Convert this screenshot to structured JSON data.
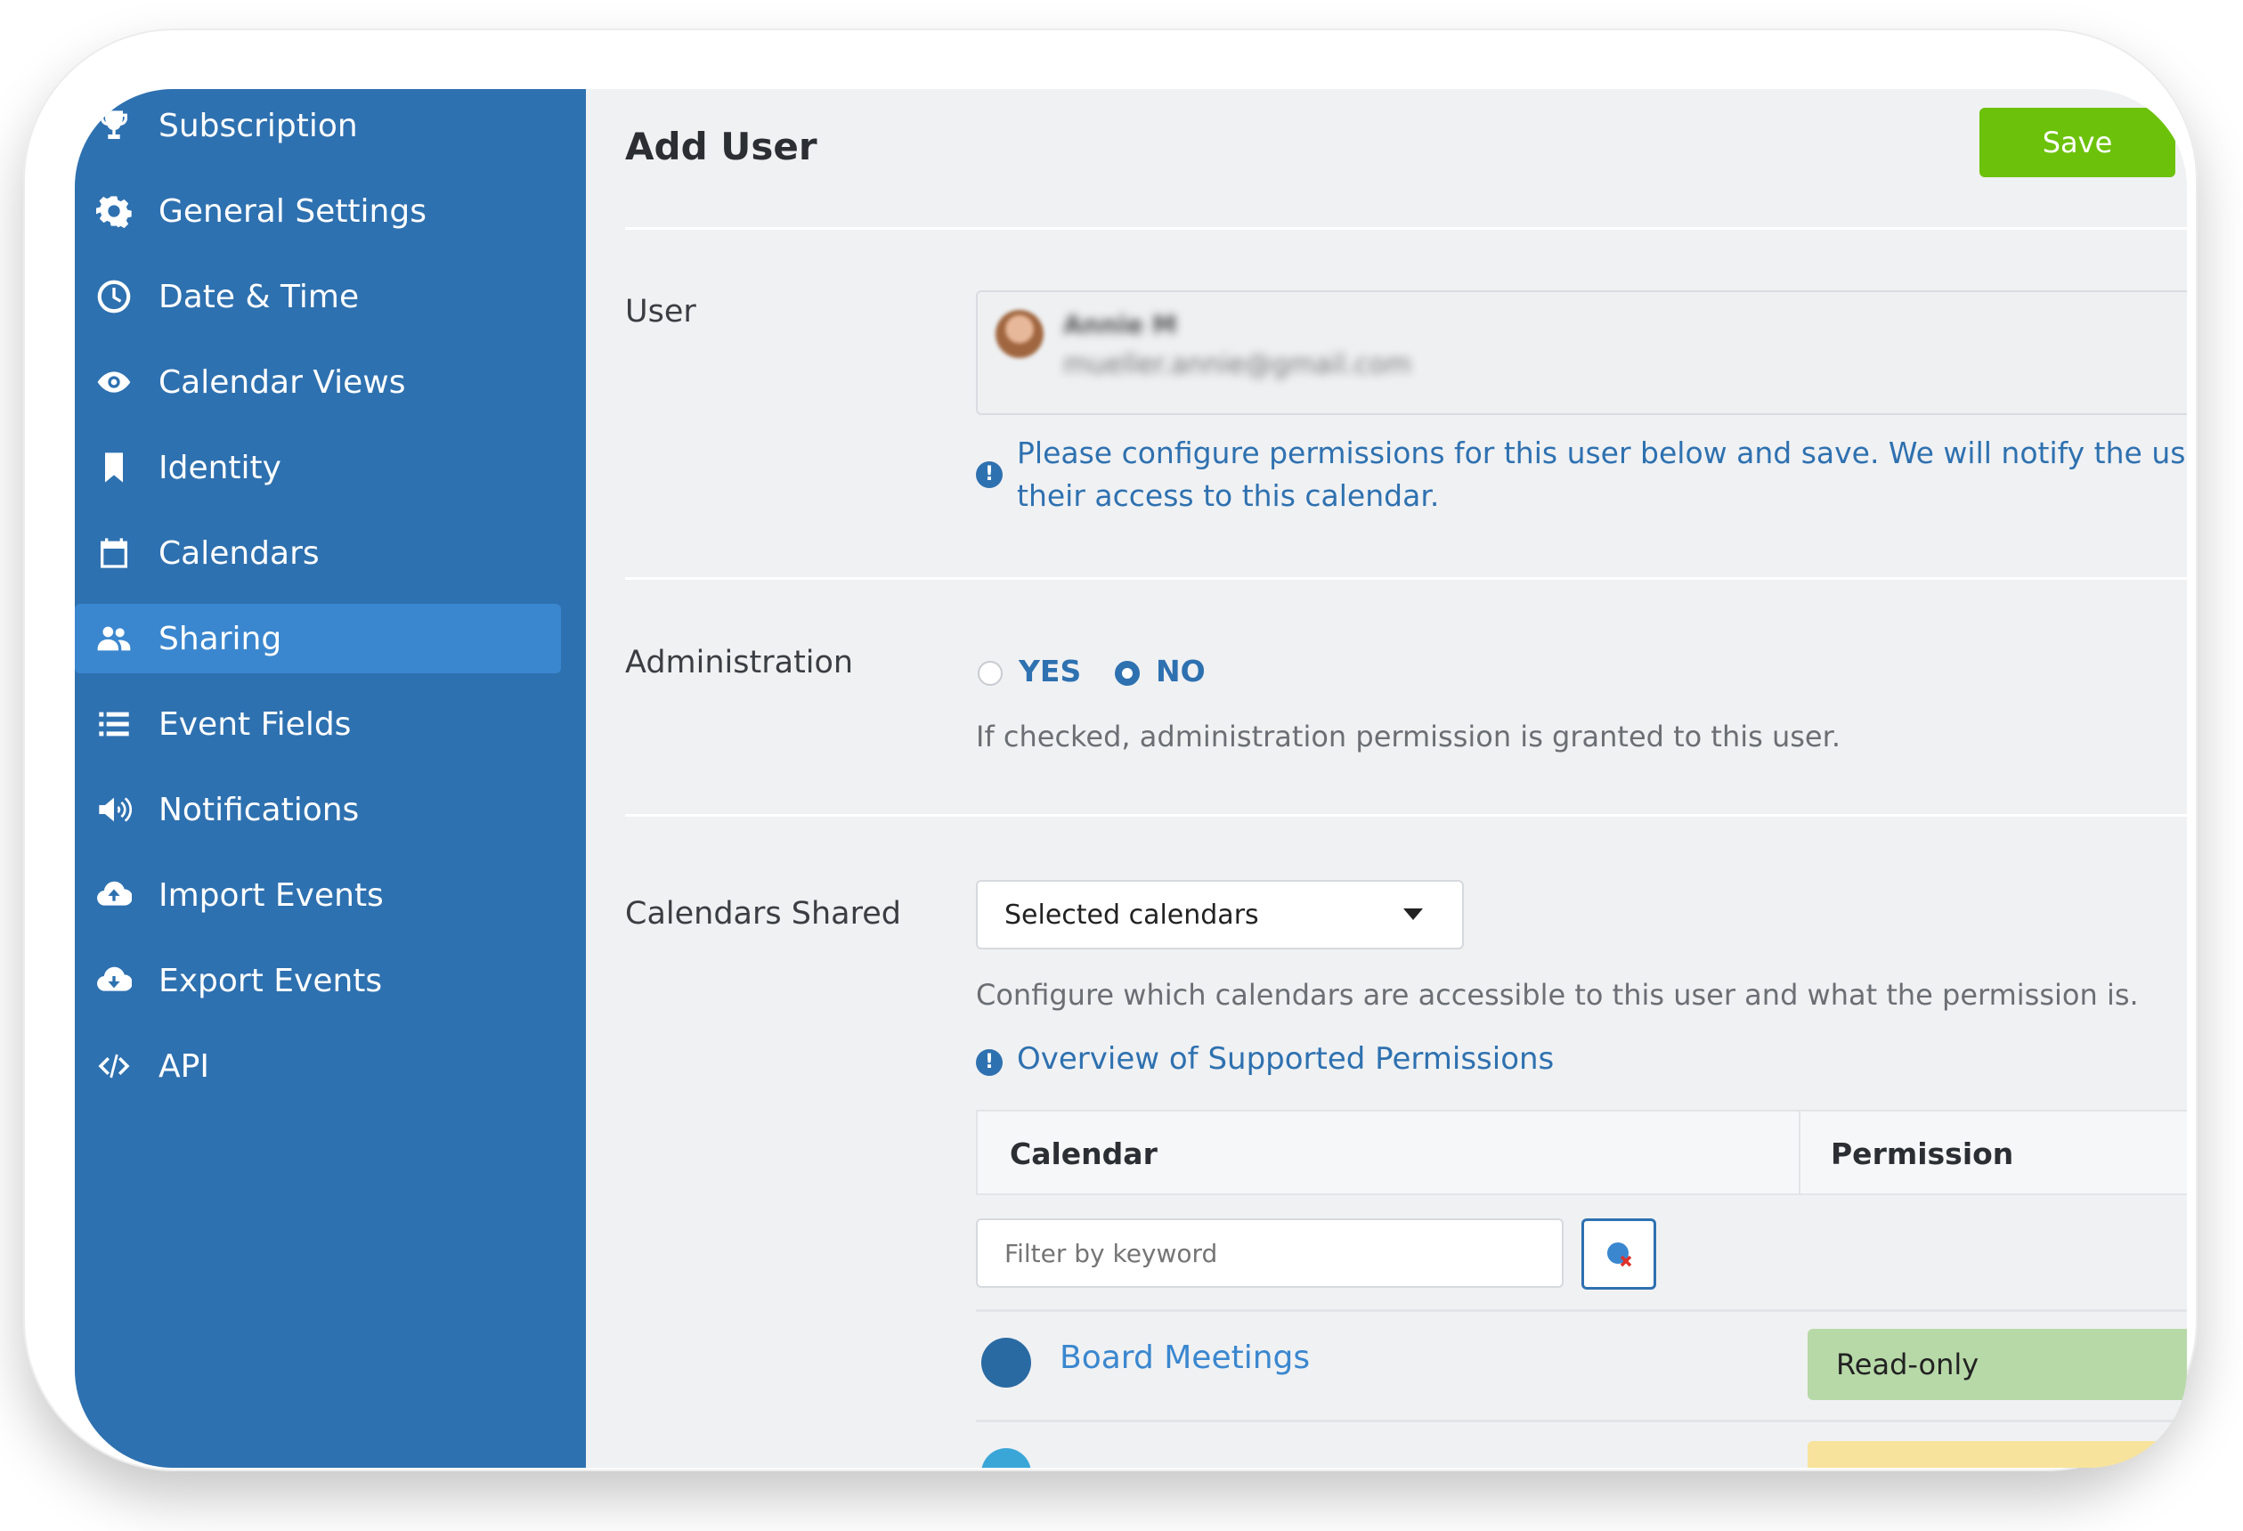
{
  "sidebar": {
    "items": [
      {
        "label": "Subscription",
        "icon": "trophy-icon"
      },
      {
        "label": "General Settings",
        "icon": "gear-icon"
      },
      {
        "label": "Date & Time",
        "icon": "clock-icon"
      },
      {
        "label": "Calendar Views",
        "icon": "eye-icon"
      },
      {
        "label": "Identity",
        "icon": "bookmark-icon"
      },
      {
        "label": "Calendars",
        "icon": "calendar-icon"
      },
      {
        "label": "Sharing",
        "icon": "users-icon",
        "active": true
      },
      {
        "label": "Event Fields",
        "icon": "list-icon"
      },
      {
        "label": "Notifications",
        "icon": "megaphone-icon"
      },
      {
        "label": "Import Events",
        "icon": "cloud-upload-icon"
      },
      {
        "label": "Export Events",
        "icon": "cloud-download-icon"
      },
      {
        "label": "API",
        "icon": "code-icon"
      }
    ]
  },
  "header": {
    "title": "Add User",
    "save_label": "Save"
  },
  "user_section": {
    "label": "User",
    "name": "Annie M",
    "email": "mueller.annie@gmail.com",
    "notice_line1": "Please configure permissions for this user below and save. We will notify the user by e",
    "notice_line2": "their access to this calendar."
  },
  "admin_section": {
    "label": "Administration",
    "yes_label": "YES",
    "no_label": "NO",
    "selected": "NO",
    "help": "If checked, administration permission is granted to this user."
  },
  "calendars_section": {
    "label": "Calendars Shared",
    "select_value": "Selected calendars",
    "help": "Configure which calendars are accessible to this user and what the permission is.",
    "overview_link": "Overview of Supported Permissions",
    "table_headers": {
      "calendar": "Calendar",
      "permission": "Permission"
    },
    "filter_placeholder": "Filter by keyword",
    "rows": [
      {
        "name": "Board Meetings",
        "color": "#2a6aa3",
        "permission": "Read-only",
        "perm_color": "#b7d9a8"
      },
      {
        "name": "",
        "color": "#3aa6d8",
        "permission": "",
        "perm_color": "#f7e39b"
      }
    ]
  },
  "colors": {
    "sidebar": "#2e71b0",
    "active_item": "#3a87cf",
    "save": "#6cc20b",
    "link": "#2e71b0"
  }
}
